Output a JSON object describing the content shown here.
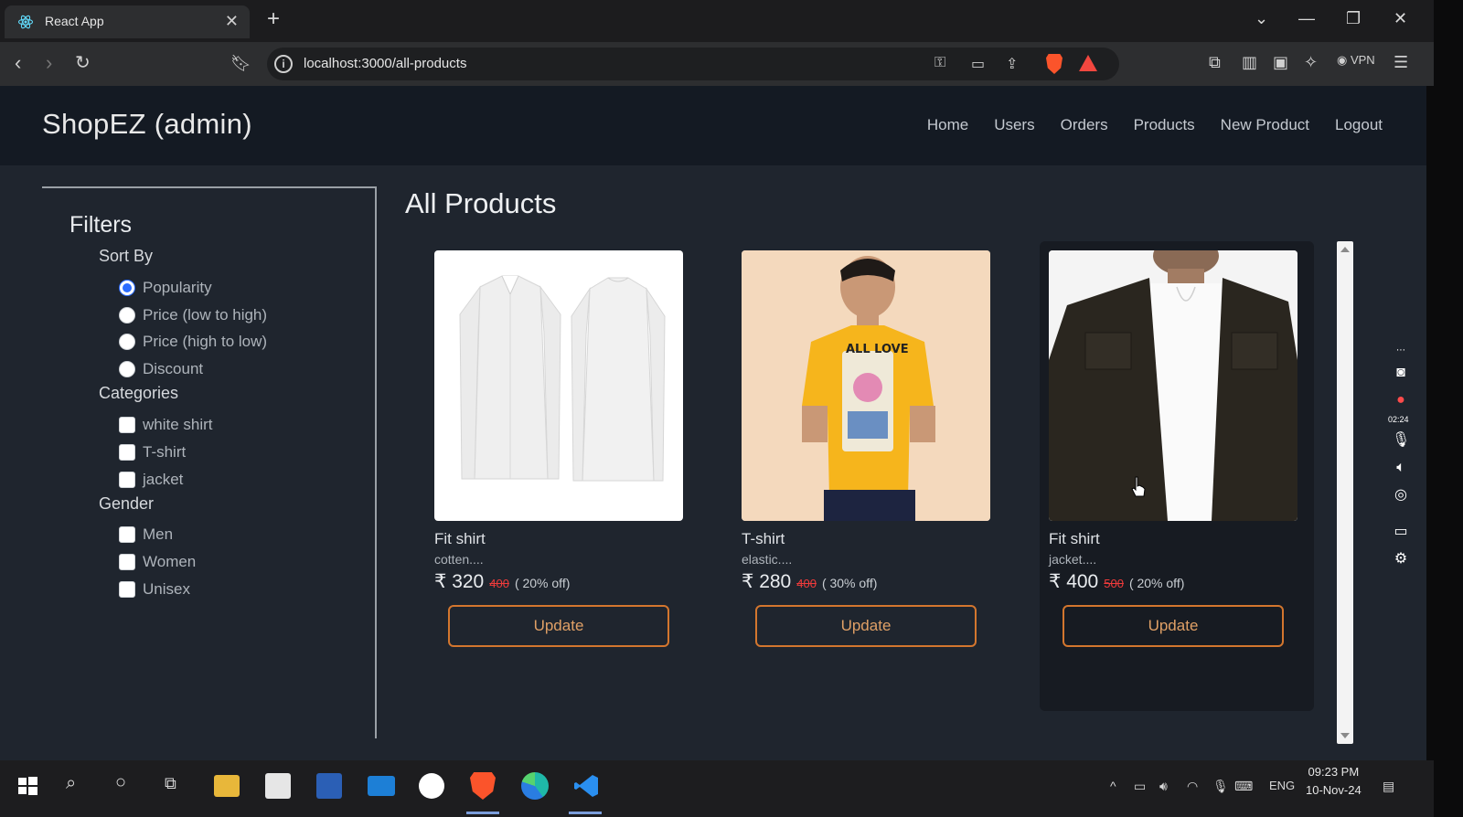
{
  "browser": {
    "tab_title": "React App",
    "tab_close": "✕",
    "new_tab": "+",
    "url": "localhost:3000/all-products",
    "vpn_label": "VPN"
  },
  "app": {
    "brand": "ShopEZ (admin)",
    "nav": [
      "Home",
      "Users",
      "Orders",
      "Products",
      "New Product",
      "Logout"
    ]
  },
  "filters": {
    "title": "Filters",
    "sort_title": "Sort By",
    "sort_options": [
      "Popularity",
      "Price (low to high)",
      "Price (high to low)",
      "Discount"
    ],
    "sort_selected": "Popularity",
    "categories_title": "Categories",
    "categories": [
      "white shirt",
      "T-shirt",
      "jacket"
    ],
    "gender_title": "Gender",
    "genders": [
      "Men",
      "Women",
      "Unisex"
    ]
  },
  "main": {
    "title": "All Products",
    "products": [
      {
        "name": "Fit shirt",
        "desc": "cotten....",
        "price": "₹ 320",
        "old_price": "400",
        "discount": "( 20% off)",
        "button": "Update"
      },
      {
        "name": "T-shirt",
        "desc": "elastic....",
        "price": "₹ 280",
        "old_price": "400",
        "discount": "( 30% off)",
        "button": "Update"
      },
      {
        "name": "Fit shirt",
        "desc": "jacket....",
        "price": "₹ 400",
        "old_price": "500",
        "discount": "( 20% off)",
        "button": "Update"
      }
    ]
  },
  "recorder": {
    "time": "02:24"
  },
  "taskbar": {
    "lang": "ENG",
    "time": "09:23 PM",
    "date": "10-Nov-24"
  },
  "colors": {
    "app_bg": "#1f252e",
    "nav_bg": "#141a23",
    "update_border": "#d3762e",
    "strike_price": "#ef3b3b",
    "radio_accent": "#2b6cff"
  }
}
